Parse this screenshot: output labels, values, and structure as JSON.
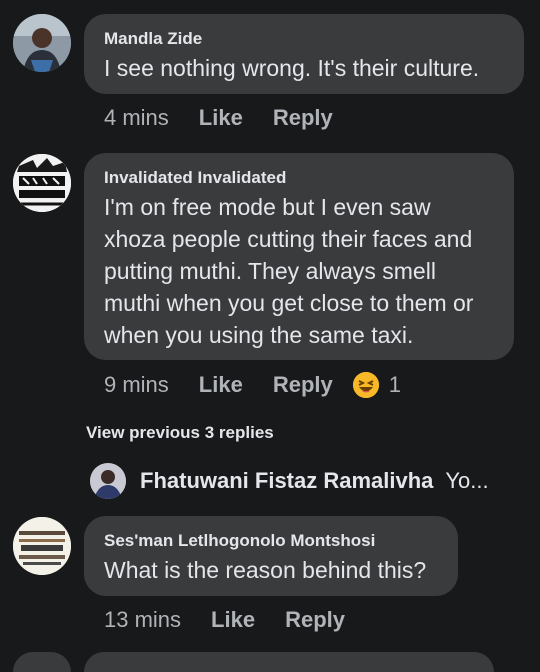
{
  "comments": [
    {
      "author": "Mandla Zide",
      "text": "I see nothing wrong. It's their culture.",
      "time": "4 mins",
      "like_label": "Like",
      "reply_label": "Reply"
    },
    {
      "author": "Invalidated Invalidated",
      "lines": [
        "I'm on free mode but I even saw",
        "xhoza people cutting their faces and",
        "putting muthi. They always smell",
        "muthi when you get close to them or",
        "when you using the same taxi."
      ],
      "time": "9 mins",
      "like_label": "Like",
      "reply_label": "Reply",
      "reaction_icon": "haha-emoji-icon",
      "reaction_count": "1"
    },
    {
      "author": "Ses'man Letlhogonolo Montshosi",
      "text": "What is the reason behind this?",
      "time": "13 mins",
      "like_label": "Like",
      "reply_label": "Reply"
    }
  ],
  "replies": {
    "view_previous_label": "View previous 3 replies",
    "preview_author": "Fhatuwani Fistaz Ramalivha",
    "preview_snippet": "Yo..."
  },
  "colors": {
    "background": "#18191a",
    "bubble": "#3a3b3c",
    "text": "#e4e6eb",
    "secondary": "#b0b3b8"
  }
}
